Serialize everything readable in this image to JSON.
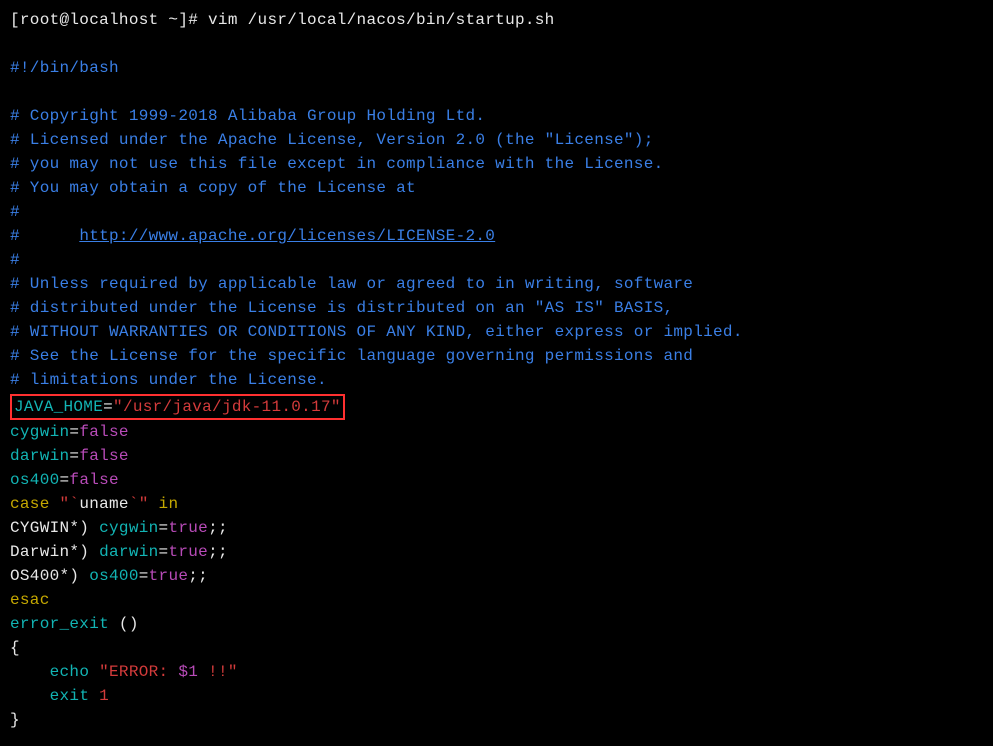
{
  "prompt": "[root@localhost ~]# vim /usr/local/nacos/bin/startup.sh",
  "blank": " ",
  "shebang": "#!/bin/bash",
  "hash": "#",
  "c1": "# Copyright 1999-2018 Alibaba Group Holding Ltd.",
  "c2": "# Licensed under the Apache License, Version 2.0 (the \"License\");",
  "c3": "# you may not use this file except in compliance with the License.",
  "c4": "# You may obtain a copy of the License at",
  "c5p": "#      ",
  "c5u": "http://www.apache.org/licenses/LICENSE-2.0",
  "c6": "# Unless required by applicable law or agreed to in writing, software",
  "c7": "# distributed under the License is distributed on an \"AS IS\" BASIS,",
  "c8": "# WITHOUT WARRANTIES OR CONDITIONS OF ANY KIND, either express or implied.",
  "c9": "# See the License for the specific language governing permissions and",
  "c10": "# limitations under the License.",
  "jh_var": "JAVA_HOME",
  "jh_eq": "=",
  "jh_q1": "\"",
  "jh_val": "/usr/java/jdk-11.0.17",
  "jh_q2": "\"",
  "cygwin_v": "cygwin",
  "darwin_v": "darwin",
  "os400_v": "os400",
  "eq": "=",
  "false_v": "false",
  "true_v": "true",
  "case_w": "case",
  "space": " ",
  "q": "\"",
  "bt": "`",
  "uname": "uname",
  "in_w": " in",
  "patCyg": "CYGWIN*) ",
  "patDar": "Darwin*) ",
  "patOs4": "OS400*) ",
  "dsc": ";;",
  "esac": "esac",
  "fn_name": "error_exit ",
  "parens": "()",
  "lbrace": "{",
  "rbrace": "}",
  "indent": "    ",
  "echo_w": "echo",
  "err_str": " \"ERROR: ",
  "dollar1": "$1",
  "bang": " !!\"",
  "exit_w": "exit",
  "one": " 1"
}
